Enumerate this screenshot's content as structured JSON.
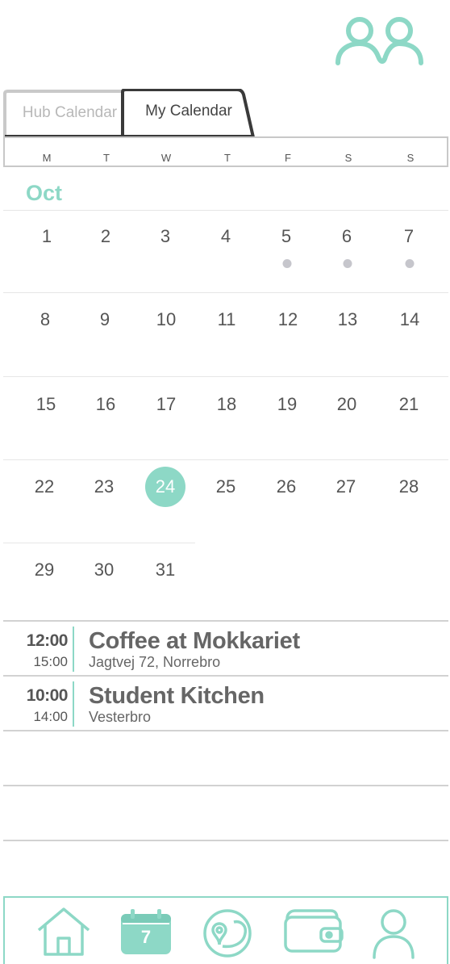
{
  "header": {
    "group_icon": "group-icon"
  },
  "tabs": [
    {
      "label": "Hub Calendar",
      "active": false
    },
    {
      "label": "My Calendar",
      "active": true
    }
  ],
  "weekdays": [
    "M",
    "T",
    "W",
    "T",
    "F",
    "S",
    "S"
  ],
  "calendar": {
    "month": "Oct",
    "weeks": [
      [
        "1",
        "2",
        "3",
        "4",
        "5",
        "6",
        "7"
      ],
      [
        "8",
        "9",
        "10",
        "11",
        "12",
        "13",
        "14"
      ],
      [
        "15",
        "16",
        "17",
        "18",
        "19",
        "20",
        "21"
      ],
      [
        "22",
        "23",
        "24",
        "25",
        "26",
        "27",
        "28"
      ],
      [
        "29",
        "30",
        "31"
      ]
    ],
    "today": "24",
    "days_with_events": [
      "5",
      "6",
      "7"
    ]
  },
  "events": [
    {
      "start": "12:00",
      "end": "15:00",
      "title": "Coffee at Mokkariet",
      "location": "Jagtvej 72, Norrebro"
    },
    {
      "start": "10:00",
      "end": "14:00",
      "title": "Student Kitchen",
      "location": "Vesterbro"
    }
  ],
  "nav": {
    "items": [
      {
        "icon": "home-icon"
      },
      {
        "icon": "calendar-icon",
        "badge": "7",
        "active": true
      },
      {
        "icon": "map-route-icon"
      },
      {
        "icon": "wallet-icon"
      },
      {
        "icon": "profile-icon"
      }
    ]
  },
  "colors": {
    "accent": "#8dd8c6",
    "text": "#555555",
    "muted": "#b8b8b8",
    "event_dot": "#c6c6cc"
  }
}
